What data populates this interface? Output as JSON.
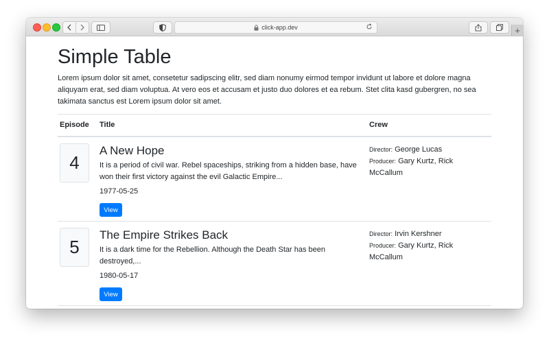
{
  "browser": {
    "url": "click-app.dev"
  },
  "page": {
    "title": "Simple Table",
    "intro": "Lorem ipsum dolor sit amet, consetetur sadipscing elitr, sed diam nonumy eirmod tempor invidunt ut labore et dolore magna aliquyam erat, sed diam voluptua. At vero eos et accusam et justo duo dolores et ea rebum. Stet clita kasd gubergren, no sea takimata sanctus est Lorem ipsum dolor sit amet."
  },
  "table": {
    "headers": [
      "Episode",
      "Title",
      "Crew"
    ],
    "rows": [
      {
        "episode": "4",
        "title": "A New Hope",
        "crawl": "It is a period of civil war. Rebel spaceships, striking from a hidden base, have won their first victory against the evil Galactic Empire...",
        "date": "1977-05-25",
        "button": "View",
        "director_label": "Director:",
        "director": "George Lucas",
        "producer_label": "Producer:",
        "producer": "Gary Kurtz, Rick McCallum"
      },
      {
        "episode": "5",
        "title": "The Empire Strikes Back",
        "crawl": "It is a dark time for the Rebellion. Although the Death Star has been destroyed,...",
        "date": "1980-05-17",
        "button": "View",
        "director_label": "Director:",
        "director": "Irvin Kershner",
        "producer_label": "Producer:",
        "producer": "Gary Kurtz, Rick McCallum"
      }
    ]
  },
  "colors": {
    "accent": "#007bff",
    "text": "#212529",
    "border": "#dee2e6"
  },
  "icons": [
    "back-icon",
    "forward-icon",
    "sidebar-icon",
    "privacy-shield-icon",
    "lock-icon",
    "reload-icon",
    "share-icon",
    "tabs-icon",
    "new-tab-icon"
  ]
}
